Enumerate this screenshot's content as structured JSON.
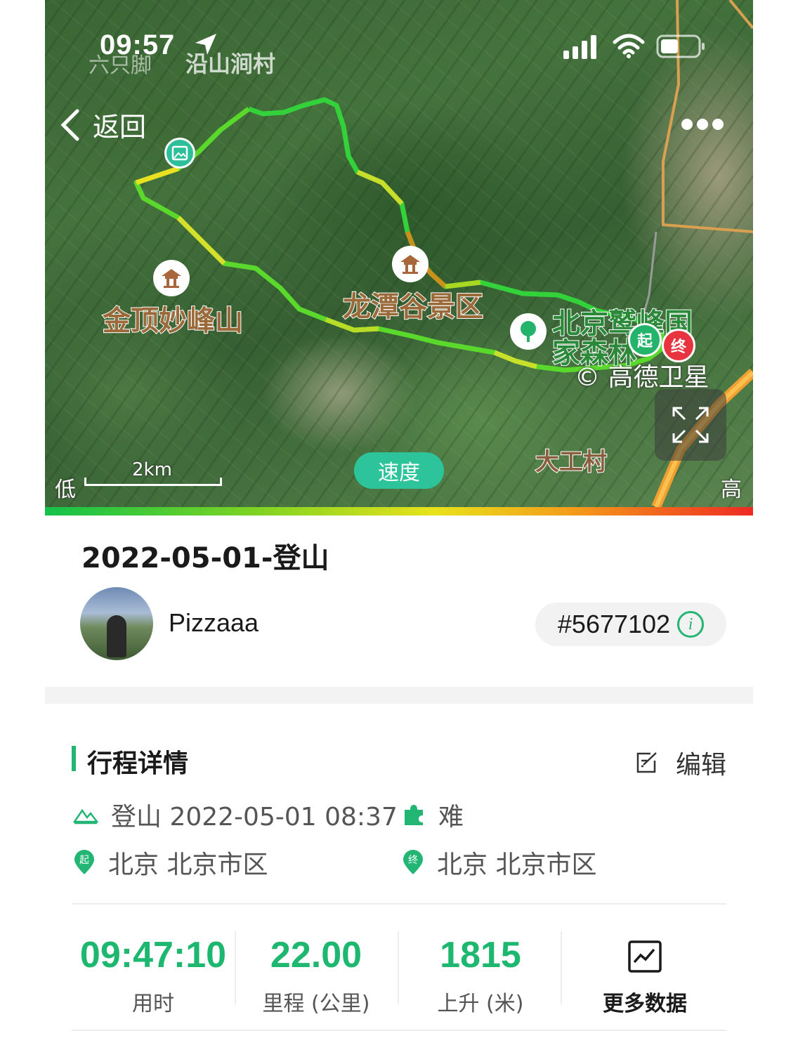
{
  "status_bar": {
    "time": "09:57",
    "watermark": "六只脚",
    "village": "沿山涧村"
  },
  "nav": {
    "back_label": "返回"
  },
  "map": {
    "labels": {
      "jinding": "金顶妙峰山",
      "longtan": "龙潭谷景区",
      "forest_line1": "北京鹫峰国",
      "forest_line2": "家森林",
      "dagong": "大工村"
    },
    "start_marker": "起",
    "end_marker": "终",
    "copyright": "© 高德卫星",
    "scale": "2km",
    "speed_button": "速度",
    "legend_low": "低",
    "legend_high": "高"
  },
  "trip": {
    "title": "2022-05-01-登山",
    "username": "Pizzaaa",
    "id": "#5677102"
  },
  "details": {
    "section_title": "行程详情",
    "edit_label": "编辑",
    "activity": "登山 2022-05-01 08:37",
    "difficulty": "难",
    "start_location": "北京 北京市区",
    "end_location": "北京 北京市区",
    "start_pin_char": "起",
    "end_pin_char": "终"
  },
  "stats": [
    {
      "value": "09:47:10",
      "label": "用时"
    },
    {
      "value": "22.00",
      "label": "里程 (公里)"
    },
    {
      "value": "1815",
      "label": "上升 (米)"
    }
  ],
  "more_data_label": "更多数据",
  "colors": {
    "accent": "#22b573",
    "stat_value": "#1db76f",
    "speed_pill": "#2dc49c",
    "start_marker": "#23b36a",
    "end_marker": "#e8343f"
  }
}
